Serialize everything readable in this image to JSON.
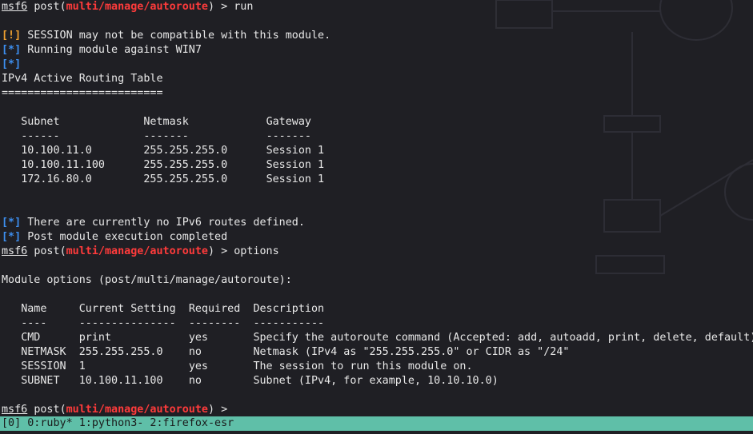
{
  "prompt": {
    "msf": "msf6",
    "cmd": "post",
    "module": "multi/manage/autoroute"
  },
  "commands": {
    "first": "run",
    "second": "options"
  },
  "messages": {
    "warn_tag": "[!]",
    "info_tag": "[*]",
    "m1": "SESSION may not be compatible with this module.",
    "m2": "Running module against WIN7",
    "m3": "There are currently no IPv6 routes defined.",
    "m4": "Post module execution completed"
  },
  "routing": {
    "title": "IPv4 Active Routing Table",
    "underline": "=========================",
    "headers": [
      "Subnet",
      "Netmask",
      "Gateway"
    ],
    "separators": [
      "------",
      "-------",
      "-------"
    ],
    "rows": [
      [
        "10.100.11.0",
        "255.255.255.0",
        "Session 1"
      ],
      [
        "10.100.11.100",
        "255.255.255.0",
        "Session 1"
      ],
      [
        "172.16.80.0",
        "255.255.255.0",
        "Session 1"
      ]
    ]
  },
  "options": {
    "title": "Module options (post/multi/manage/autoroute):",
    "headers": [
      "Name",
      "Current Setting",
      "Required",
      "Description"
    ],
    "separators": [
      "----",
      "---------------",
      "--------",
      "-----------"
    ],
    "rows": [
      [
        "CMD",
        "print",
        "yes",
        "Specify the autoroute command (Accepted: add, autoadd, print, delete, default)"
      ],
      [
        "NETMASK",
        "255.255.255.0",
        "no",
        "Netmask (IPv4 as \"255.255.255.0\" or CIDR as \"/24\""
      ],
      [
        "SESSION",
        "1",
        "yes",
        "The session to run this module on."
      ],
      [
        "SUBNET",
        "10.100.11.100",
        "no",
        "Subnet (IPv4, for example, 10.10.10.0)"
      ]
    ]
  },
  "statusbar": {
    "session": "[0]",
    "windows": "0:ruby* 1:python3- 2:firefox-esr"
  },
  "colors": {
    "bg": "#1f1f24",
    "module": "#ff3b3b",
    "warn": "#f0a030",
    "info": "#3d8ff0",
    "statusbar": "#5fbfa8"
  }
}
